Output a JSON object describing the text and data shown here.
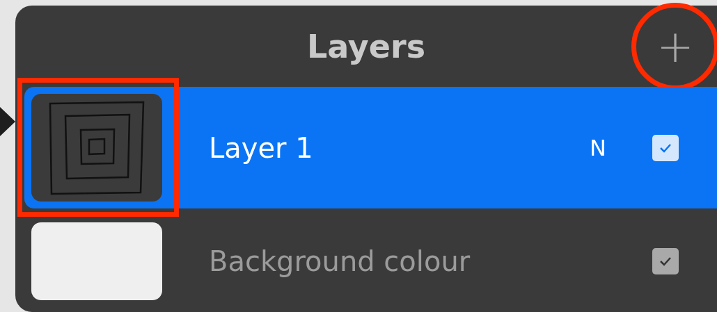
{
  "panel": {
    "title": "Layers",
    "add_button": {
      "label": "+",
      "highlighted": true
    }
  },
  "layers": [
    {
      "kind": "drawing",
      "name": "Layer 1",
      "blend_mode": "N",
      "selected": true,
      "visible": true,
      "highlighted": true
    },
    {
      "kind": "colour",
      "name": "Background colour",
      "selected": false,
      "visible": true,
      "highlighted": false
    }
  ]
}
